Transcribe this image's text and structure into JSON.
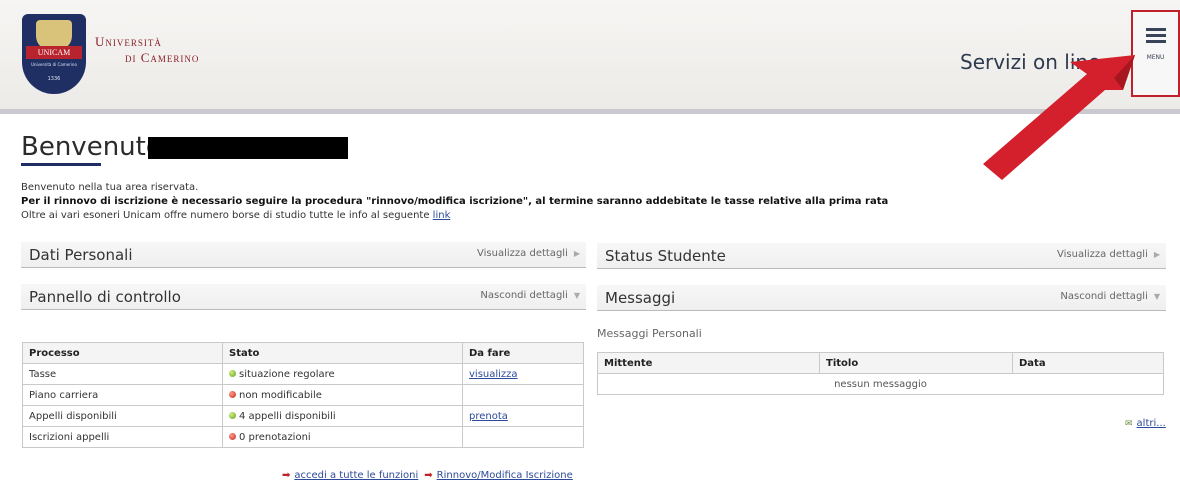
{
  "header": {
    "logo": {
      "banner": "UNICAM",
      "sub": "Università di Camerino",
      "year": "1336",
      "name_line1": "Università",
      "name_line2": "di Camerino"
    },
    "servizi": "Servizi on line",
    "menu_label": "MENU"
  },
  "welcome": {
    "title": "Benvenuto",
    "line1": "Benvenuto nella tua area riservata.",
    "line2": "Per il rinnovo di iscrizione è necessario seguire la procedura \"rinnovo/modifica iscrizione\", al termine saranno addebitate le tasse relative alla prima rata",
    "line3_text": "Oltre ai vari esoneri Unicam offre numero borse di studio tutte le info al seguente ",
    "line3_link": "link"
  },
  "panels": {
    "dati_personali": {
      "title": "Dati Personali",
      "link": "Visualizza dettagli"
    },
    "pannello": {
      "title": "Pannello di controllo",
      "link": "Nascondi dettagli"
    },
    "status": {
      "title": "Status Studente",
      "link": "Visualizza dettagli"
    },
    "messaggi": {
      "title": "Messaggi",
      "link": "Nascondi dettagli"
    }
  },
  "process_table": {
    "headers": [
      "Processo",
      "Stato",
      "Da fare"
    ],
    "rows": [
      {
        "processo": "Tasse",
        "stato": "situazione regolare",
        "status_color": "#5aa12a",
        "da_fare": "visualizza"
      },
      {
        "processo": "Piano carriera",
        "stato": "non modificabile",
        "status_color": "#c42b1e",
        "da_fare": ""
      },
      {
        "processo": "Appelli disponibili",
        "stato": "4 appelli disponibili",
        "status_color": "#5aa12a",
        "da_fare": "prenota"
      },
      {
        "processo": "Iscrizioni appelli",
        "stato": "0 prenotazioni",
        "status_color": "#c42b1e",
        "da_fare": ""
      }
    ]
  },
  "bottom_links": {
    "link1": "accedi a tutte le funzioni",
    "link2": "Rinnovo/Modifica Iscrizione"
  },
  "messages": {
    "subtitle": "Messaggi Personali",
    "headers": [
      "Mittente",
      "Titolo",
      "Data"
    ],
    "empty": "nessun messaggio",
    "altri": "altri..."
  },
  "colors": {
    "accent": "#1f2f63",
    "arrow": "#c0202a",
    "link": "#2c4a9a"
  }
}
